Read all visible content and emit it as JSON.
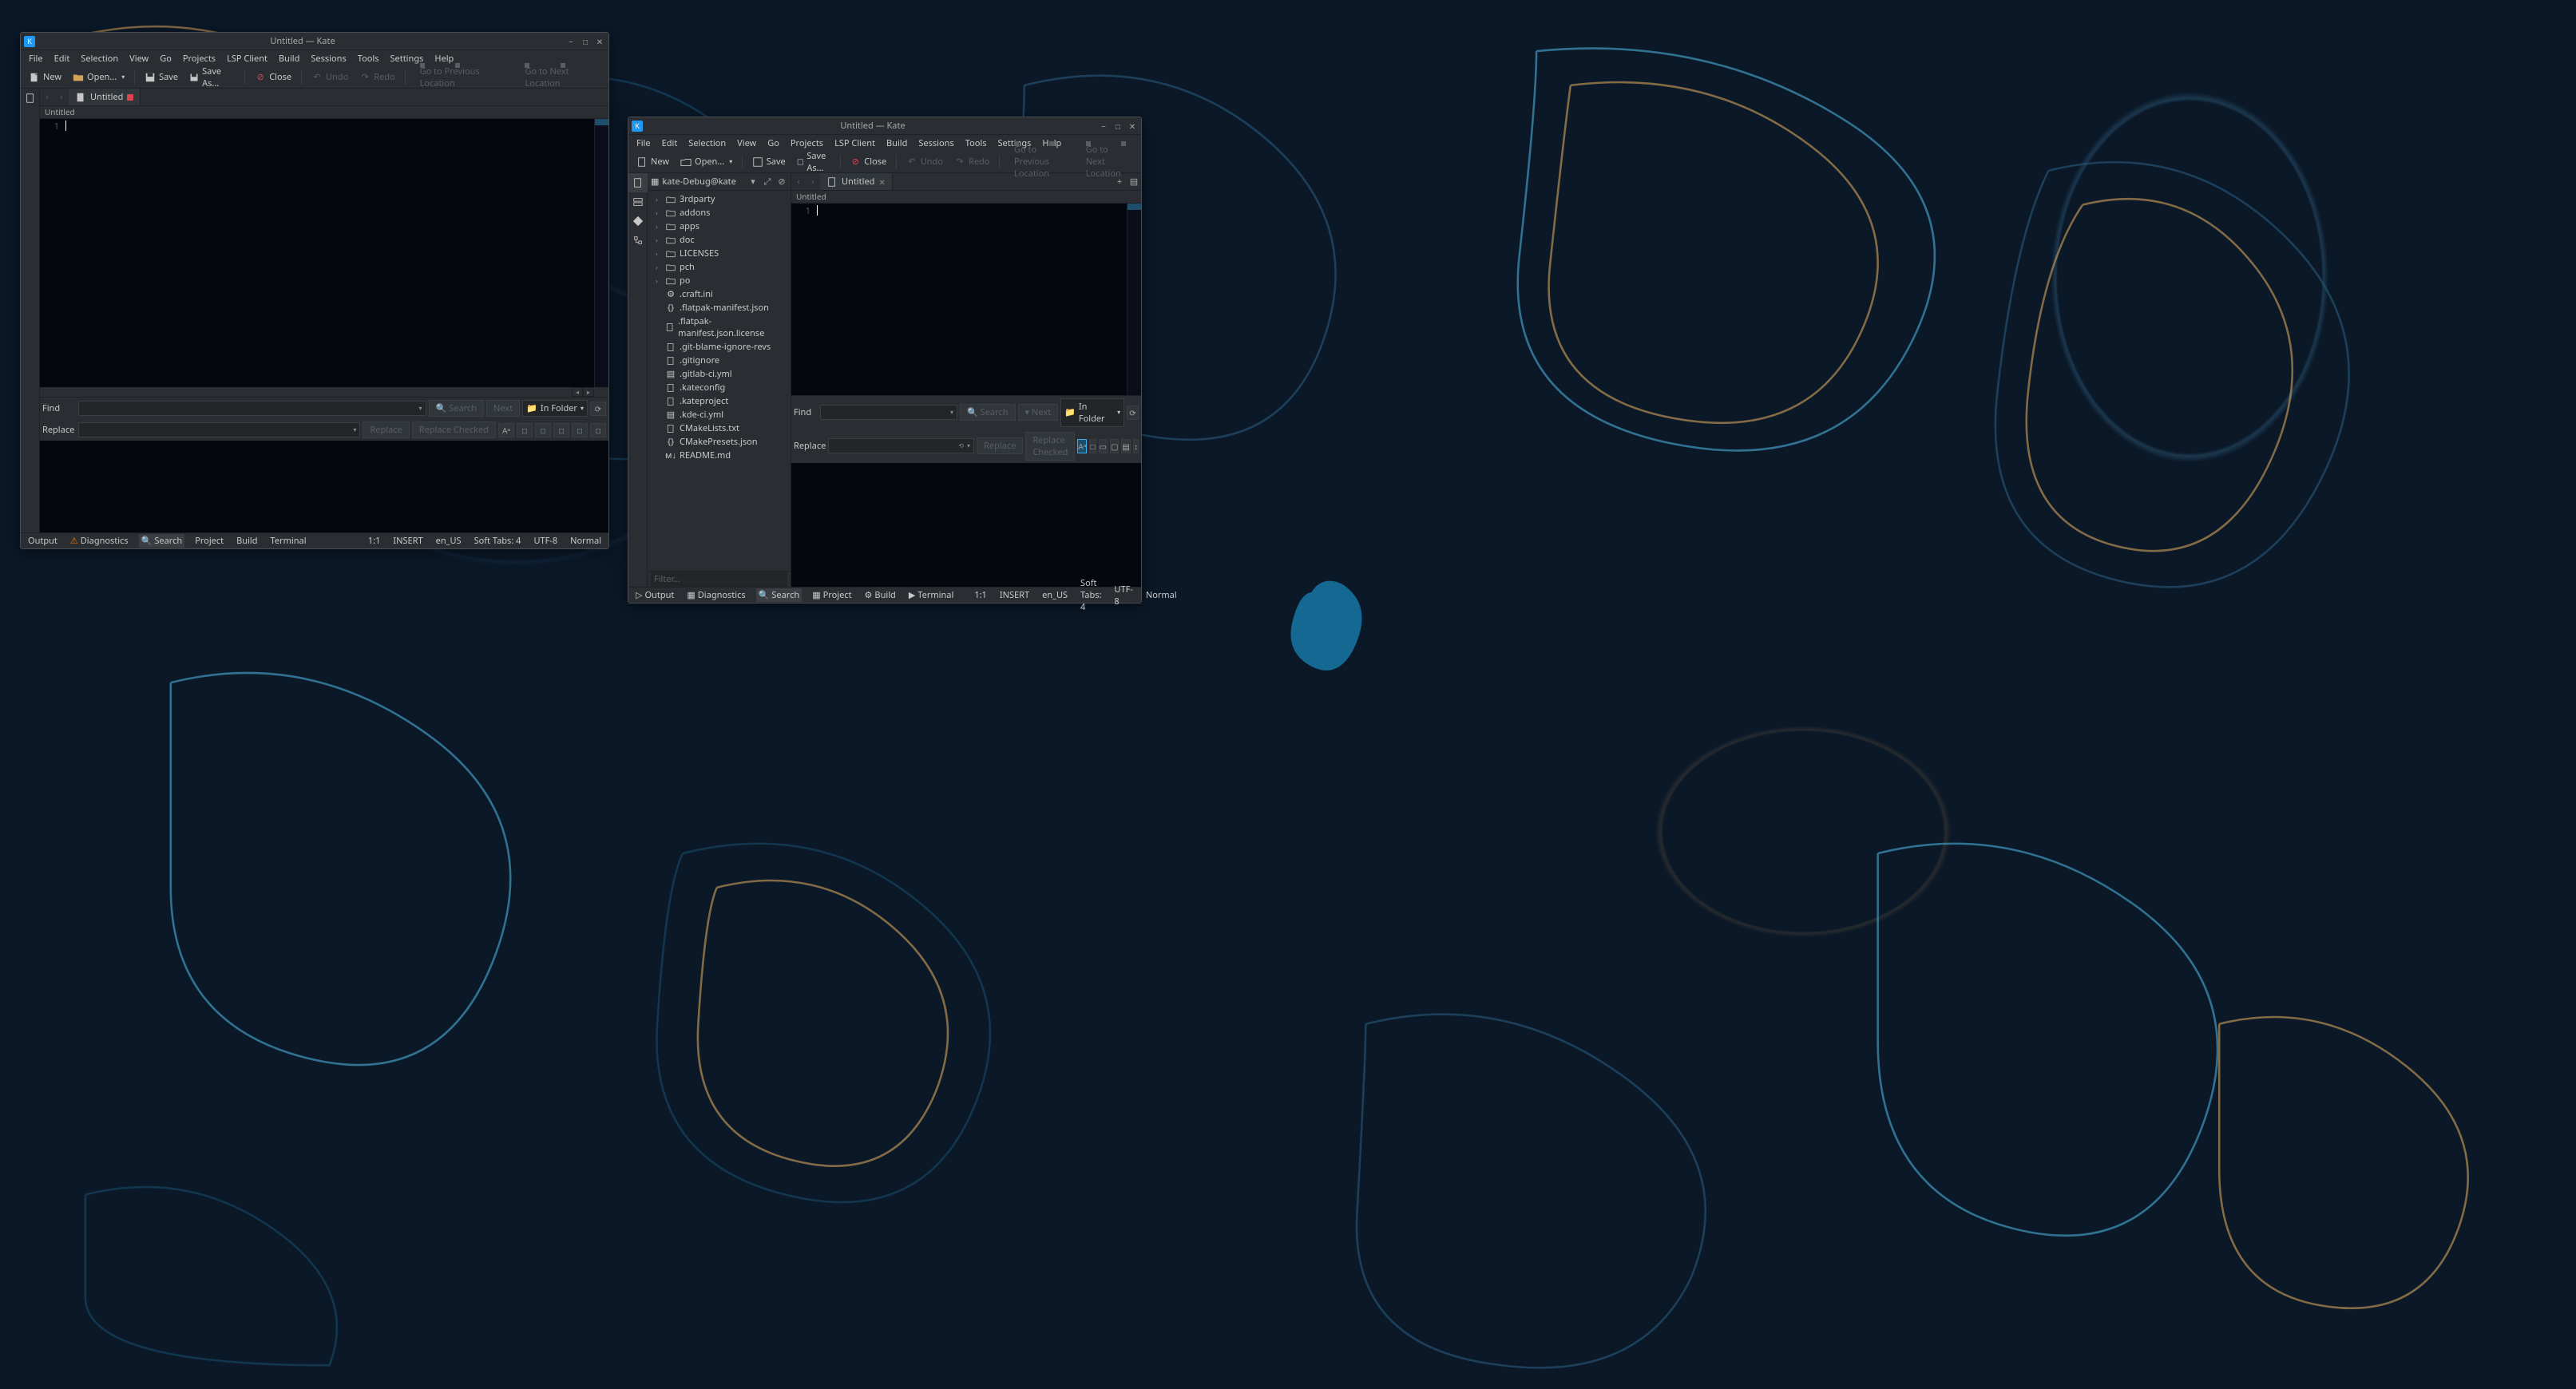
{
  "window1": {
    "title": "Untitled  — Kate",
    "menubar": [
      "File",
      "Edit",
      "Selection",
      "View",
      "Go",
      "Projects",
      "LSP Client",
      "Build",
      "Sessions",
      "Tools",
      "Settings",
      "Help"
    ],
    "toolbar": {
      "new": "New",
      "open": "Open...",
      "save": "Save",
      "saveas": "Save As...",
      "close": "Close",
      "undo": "Undo",
      "redo": "Redo",
      "prevloc": "Go to Previous Location",
      "nextloc": "Go to Next Location"
    },
    "tab": {
      "name": "Untitled",
      "modified": true
    },
    "doc_header": "Untitled",
    "gutter_first_line": "1",
    "search": {
      "find_label": "Find",
      "replace_label": "Replace",
      "search_btn": "Search",
      "next_btn": "Next",
      "in_folder": "In Folder",
      "replace_btn": "Replace",
      "replace_checked_btn": "Replace Checked"
    },
    "status": {
      "output": "Output",
      "diagnostics": "Diagnostics",
      "search": "Search",
      "project": "Project",
      "build": "Build",
      "terminal": "Terminal",
      "cursor": "1:1",
      "mode": "INSERT",
      "locale": "en_US",
      "tabs": "Soft Tabs: 4",
      "encoding": "UTF-8",
      "lang": "Normal"
    }
  },
  "window2": {
    "title": "Untitled  — Kate",
    "menubar": [
      "File",
      "Edit",
      "Selection",
      "View",
      "Go",
      "Projects",
      "LSP Client",
      "Build",
      "Sessions",
      "Tools",
      "Settings",
      "Help"
    ],
    "toolbar": {
      "new": "New",
      "open": "Open...",
      "save": "Save",
      "saveas": "Save As...",
      "close": "Close",
      "undo": "Undo",
      "redo": "Redo",
      "prevloc": "Go to Previous Location",
      "nextloc": "Go to Next Location"
    },
    "project_name": "kate-Debug@kate",
    "tree": [
      {
        "type": "folder",
        "name": "3rdparty"
      },
      {
        "type": "folder",
        "name": "addons"
      },
      {
        "type": "folder",
        "name": "apps"
      },
      {
        "type": "folder",
        "name": "doc"
      },
      {
        "type": "folder",
        "name": "LICENSES"
      },
      {
        "type": "folder",
        "name": "pch"
      },
      {
        "type": "folder",
        "name": "po"
      },
      {
        "type": "file",
        "icon": "cog",
        "name": ".craft.ini"
      },
      {
        "type": "file",
        "icon": "json",
        "name": ".flatpak-manifest.json"
      },
      {
        "type": "file",
        "icon": "txt",
        "name": ".flatpak-manifest.json.license"
      },
      {
        "type": "file",
        "icon": "txt",
        "name": ".git-blame-ignore-revs"
      },
      {
        "type": "file",
        "icon": "txt",
        "name": ".gitignore"
      },
      {
        "type": "file",
        "icon": "yml",
        "name": ".gitlab-ci.yml"
      },
      {
        "type": "file",
        "icon": "txt",
        "name": ".kateconfig"
      },
      {
        "type": "file",
        "icon": "txt",
        "name": ".kateproject"
      },
      {
        "type": "file",
        "icon": "yml",
        "name": ".kde-ci.yml"
      },
      {
        "type": "file",
        "icon": "txt",
        "name": "CMakeLists.txt"
      },
      {
        "type": "file",
        "icon": "json",
        "name": "CMakePresets.json"
      },
      {
        "type": "file",
        "icon": "md",
        "name": "README.md"
      }
    ],
    "filter_placeholder": "Filter...",
    "tab": {
      "name": "Untitled",
      "modified": false
    },
    "doc_header": "Untitled",
    "gutter_first_line": "1",
    "search": {
      "find_label": "Find",
      "replace_label": "Replace",
      "search_btn": "Search",
      "next_btn": "Next",
      "in_folder": "In Folder",
      "replace_btn": "Replace",
      "replace_checked_btn": "Replace Checked"
    },
    "status": {
      "output": "Output",
      "diagnostics": "Diagnostics",
      "search": "Search",
      "project": "Project",
      "build": "Build",
      "terminal": "Terminal",
      "cursor": "1:1",
      "mode": "INSERT",
      "locale": "en_US",
      "tabs": "Soft Tabs: 4",
      "encoding": "UTF-8",
      "lang": "Normal"
    }
  }
}
